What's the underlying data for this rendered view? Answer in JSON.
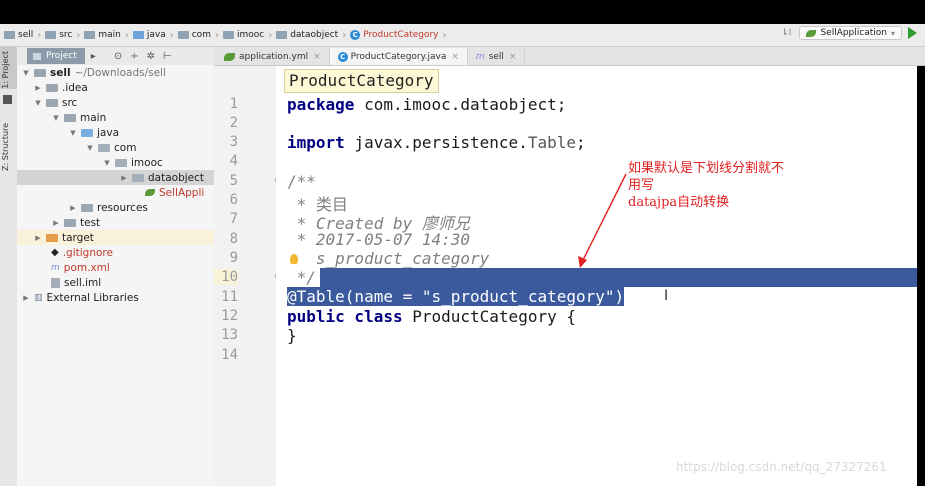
{
  "breadcrumb": {
    "items": [
      "sell",
      "src",
      "main",
      "java",
      "com",
      "imooc",
      "dataobject"
    ],
    "current": "ProductCategory"
  },
  "run": {
    "config": "SellApplication",
    "sort_icon": "sort-icon",
    "run_icon": "run-icon"
  },
  "side_strip": {
    "project_label": "1: Project",
    "structure_label": "Z: Structure"
  },
  "project_panel": {
    "title": "Project",
    "tree": [
      {
        "label": "sell",
        "suffix": "~/Downloads/sell",
        "depth": 0,
        "arrow": "▼"
      },
      {
        "label": ".idea",
        "depth": 1,
        "arrow": "▶"
      },
      {
        "label": "src",
        "depth": 1,
        "arrow": "▼"
      },
      {
        "label": "main",
        "depth": 2,
        "arrow": "▼"
      },
      {
        "label": "java",
        "depth": 3,
        "arrow": "▼"
      },
      {
        "label": "com",
        "depth": 4,
        "arrow": "▼"
      },
      {
        "label": "imooc",
        "depth": 5,
        "arrow": "▼"
      },
      {
        "label": "dataobject",
        "depth": 6,
        "arrow": "▶"
      },
      {
        "label": "SellAppli",
        "depth": 7,
        "arrow": ""
      },
      {
        "label": "resources",
        "depth": 3,
        "arrow": "▶"
      },
      {
        "label": "test",
        "depth": 2,
        "arrow": "▶"
      },
      {
        "label": "target",
        "depth": 1,
        "arrow": "▶"
      },
      {
        "label": ".gitignore",
        "depth": 1,
        "arrow": ""
      },
      {
        "label": "pom.xml",
        "depth": 1,
        "arrow": ""
      },
      {
        "label": "sell.iml",
        "depth": 1,
        "arrow": ""
      },
      {
        "label": "External Libraries",
        "depth": 0,
        "arrow": "▶"
      }
    ]
  },
  "tabs": [
    {
      "label": "application.yml",
      "close": "×"
    },
    {
      "label": "ProductCategory.java",
      "close": "×"
    },
    {
      "label": "sell",
      "close": "×"
    }
  ],
  "editor": {
    "popup": "ProductCategory",
    "line_numbers": [
      "1",
      "2",
      "3",
      "4",
      "5",
      "6",
      "7",
      "8",
      "9",
      "10",
      "11",
      "12",
      "13",
      "14"
    ],
    "lines": {
      "l1_kw": "package",
      "l1_rest": " com.imooc.dataobject;",
      "l3_kw": "import",
      "l3_rest": " javax.persistence.",
      "l3_cls": "Table",
      "l3_end": ";",
      "l5": "/**",
      "l6": " * 类目",
      "l7": " * Created by 廖师兄",
      "l8": " * 2017-05-07 14:30",
      "l9": "   s_product_category",
      "l10": " */",
      "l11": "@Table(name = \"s_product_category\")",
      "l12_kw": "public class",
      "l12_rest": " ProductCategory {",
      "l13": "}"
    }
  },
  "annotation": {
    "line1": "如果默认是下划线分割就不",
    "line2": "用写",
    "line3": "datajpa自动转换",
    "color": "#e02020"
  },
  "watermark": "https://blog.csdn.net/qq_27327261"
}
